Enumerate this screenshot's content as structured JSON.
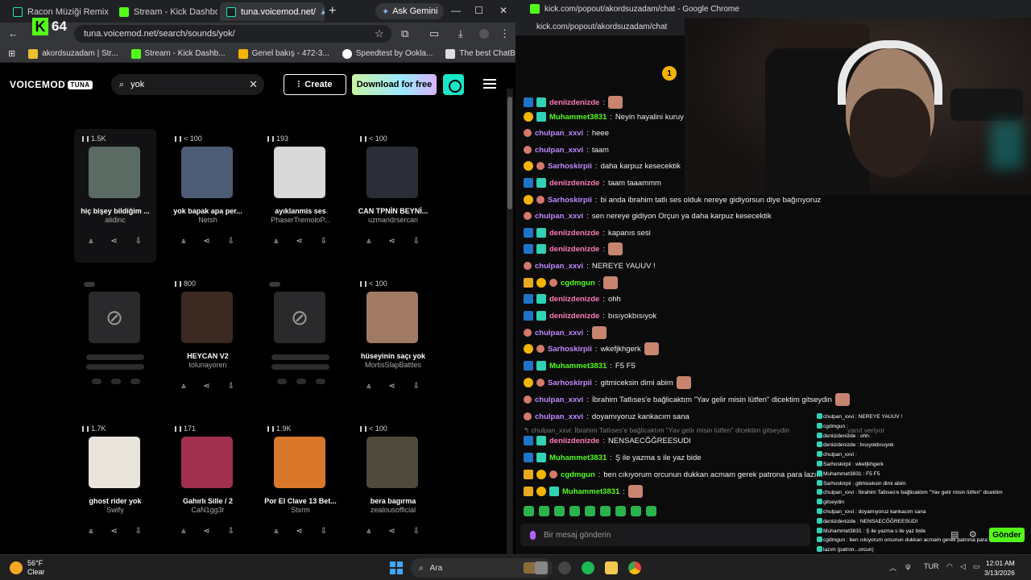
{
  "left_browser": {
    "tabs": [
      {
        "label": "Racon Müziği Remix Tü",
        "favicon": "voicemod-icon"
      },
      {
        "label": "Stream - Kick Dashboar",
        "favicon": "kick-icon"
      },
      {
        "label": "tuna.voicemod.net/",
        "favicon": "voicemod-icon"
      }
    ],
    "ask_gemini": "Ask Gemini",
    "url": "tuna.voicemod.net/search/sounds/yok/",
    "badge_letter": "K",
    "badge_number": "64",
    "bookmarks": [
      "akordsuzadam | Str...",
      "Stream - Kick Dashb...",
      "Genel bakış - 472-3...",
      "Speedtest by Ookla...",
      "The best ChatBot an..."
    ]
  },
  "voicemod": {
    "logo": "VOICEMOD",
    "logo_tag": "TUNA",
    "search_value": "yok",
    "create_label": "Create",
    "download_label": "Download for free",
    "cards": [
      {
        "plays": "1.5K",
        "title": "hiç bişey bildiğim ...",
        "author": "alidinc",
        "thumb": "#5b6b63",
        "placeholder": false
      },
      {
        "plays": "< 100",
        "title": "yok bapak apa per...",
        "author": "Netsh",
        "thumb": "#4d5c75",
        "placeholder": false
      },
      {
        "plays": "193",
        "title": "ayıklanmis ses",
        "author": "PhaserTremoloP...",
        "thumb": "#d9d9d9",
        "placeholder": false
      },
      {
        "plays": "< 100",
        "title": "CAN TPNİN BEYNİ...",
        "author": "uzmandrsercan",
        "thumb": "#2b2e36",
        "placeholder": false
      },
      {
        "plays": "",
        "title": "",
        "author": "",
        "thumb": "",
        "placeholder": true
      },
      {
        "plays": "800",
        "title": "HEYCAN V2",
        "author": "tolunayoren",
        "thumb": "#3b2a22",
        "placeholder": false
      },
      {
        "plays": "",
        "title": "",
        "author": "",
        "thumb": "",
        "placeholder": true
      },
      {
        "plays": "< 100",
        "title": "hüseyinin saçı yok",
        "author": "MortisSlapBattles",
        "thumb": "#a17a63",
        "placeholder": false
      },
      {
        "plays": "1.7K",
        "title": "ghost rider yok",
        "author": "Swify",
        "thumb": "#e9e4dc",
        "placeholder": false
      },
      {
        "plays": "171",
        "title": "Gahırlı Sille / 2",
        "author": "CaN1gg3r",
        "thumb": "#a0304e",
        "placeholder": false
      },
      {
        "plays": "1.9K",
        "title": "Por El Clave 13 Bet...",
        "author": "Stxrm",
        "thumb": "#d9772a",
        "placeholder": false
      },
      {
        "plays": "< 100",
        "title": "bera bagırma",
        "author": "zealousofficial",
        "thumb": "#4f4a3c",
        "placeholder": false
      }
    ]
  },
  "chat_window": {
    "title": "kick.com/popout/akordsuzadam/chat - Google Chrome",
    "url": "kick.com/popout/akordsuzadam/chat",
    "input_placeholder": "Bir mesaj gönderin",
    "send_label": "Gönder",
    "messages": [
      {
        "user": "deniizdenizde",
        "text": "",
        "color": "pink",
        "badges": [
          "gift",
          "sub"
        ],
        "emote": true
      },
      {
        "user": "Muhammet3831",
        "text": "Neyin hayalini kuruy",
        "color": "green",
        "badges": [
          "gold",
          "sub"
        ],
        "emote": false
      },
      {
        "user": "chulpan_xxvi",
        "text": "heee",
        "color": "purple",
        "badges": [
          "star"
        ],
        "emote": false
      },
      {
        "user": "chulpan_xxvi",
        "text": "taam",
        "color": "purple",
        "badges": [
          "star"
        ],
        "emote": false
      },
      {
        "user": "Sarhoskirpii",
        "text": "daha karpuz kesecektik",
        "color": "purple",
        "badges": [
          "gold",
          "star"
        ],
        "emote": false
      },
      {
        "user": "deniizdenizde",
        "text": "taam taaammm",
        "color": "pink",
        "badges": [
          "gift",
          "sub"
        ],
        "emote": false
      },
      {
        "user": "Sarhoskirpii",
        "text": "bi anda ibrahim tatlı ses olduk nereye gidiyorsun diye bağırıyoruz",
        "color": "purple",
        "badges": [
          "gold",
          "star"
        ],
        "emote": false
      },
      {
        "user": "chulpan_xxvi",
        "text": "sen nereye gidiyon Orçun ya daha karpuz kesecektik",
        "color": "purple",
        "badges": [
          "star"
        ],
        "emote": false
      },
      {
        "user": "deniizdenizde",
        "text": "kapanıs sesi",
        "color": "pink",
        "badges": [
          "gift",
          "sub"
        ],
        "emote": false
      },
      {
        "user": "deniizdenizde",
        "text": "",
        "color": "pink",
        "badges": [
          "gift",
          "sub"
        ],
        "emote": true
      },
      {
        "user": "chulpan_xxvi",
        "text": "NEREYE YAUUV !",
        "color": "purple",
        "badges": [
          "star"
        ],
        "emote": false
      },
      {
        "user": "cgdmgun",
        "text": "",
        "color": "green",
        "badges": [
          "crown",
          "gold",
          "star"
        ],
        "emote": true
      },
      {
        "user": "deniizdenizde",
        "text": "ohh",
        "color": "pink",
        "badges": [
          "gift",
          "sub"
        ],
        "emote": false
      },
      {
        "user": "deniizdenizde",
        "text": "bısıyokbısıyok",
        "color": "pink",
        "badges": [
          "gift",
          "sub"
        ],
        "emote": false
      },
      {
        "user": "chulpan_xxvi",
        "text": "",
        "color": "purple",
        "badges": [
          "star"
        ],
        "emote": true
      },
      {
        "user": "Sarhoskirpii",
        "text": "wkefjkhgerk",
        "color": "purple",
        "badges": [
          "gold",
          "star"
        ],
        "emote": true
      },
      {
        "user": "Muhammet3831",
        "text": "F5 F5",
        "color": "green",
        "badges": [
          "gift",
          "sub"
        ],
        "emote": false
      },
      {
        "user": "Sarhoskirpii",
        "text": "gitmiceksin dimi abim",
        "color": "purple",
        "badges": [
          "gold",
          "star"
        ],
        "emote": true
      },
      {
        "user": "chulpan_xxvi",
        "text": "İbrahim Tatlıses'e bağlicaktım \"Yav gelir misin lütfen\" dicektim gitseydin",
        "color": "purple",
        "badges": [
          "star"
        ],
        "emote": true
      },
      {
        "user": "chulpan_xxvi",
        "text": "doyamıyoruz kankacım sana",
        "color": "purple",
        "badges": [
          "star"
        ],
        "emote": false
      },
      {
        "user": "deniizdenizde",
        "text": "NENSAECĞĞREESUDI",
        "color": "pink",
        "badges": [
          "gift",
          "sub"
        ],
        "emote": false
      },
      {
        "user": "Muhammet3831",
        "text": "Ş ile yazma s ile yaz bide",
        "color": "green",
        "badges": [
          "gift",
          "sub"
        ],
        "emote": false
      },
      {
        "user": "cgdmgun",
        "text": "ben cıkıyorum orcunun dukkan acmam gerek patrona para lazım",
        "color": "green",
        "badges": [
          "crown",
          "gold",
          "star"
        ],
        "emote": false
      },
      {
        "user": "Muhammet3831",
        "text": "",
        "color": "green",
        "badges": [
          "crown",
          "gold",
          "sub"
        ],
        "emote": true
      }
    ],
    "reply_ghost": "chulpan_xxvi: İbrahim Tatlıses'e bağlicaktım \"Yav gelir misin lütfen\" dicektim gitseydin",
    "ghost_tail": "yanıt veriyor"
  },
  "overlay": {
    "lines": [
      "chulpan_xxvi : NEREYE YAUUV !",
      "cgdmgun :",
      "deniizdenizde : ohh",
      "deniizdenizde : bısıyokbısıyok",
      "chulpan_xxvi :",
      "Sarhoskirpii : wkefjkhgerk",
      "Muhammet3831 : F5 F5",
      "Sarhoskirpii : gitmiceksin dimi abim",
      "chulpan_xxvi : İbrahim Tatlıses'e bağlicaktım \"Yav gelir misin lütfen\" dicektim",
      "gitseydin",
      "chulpan_xxvi : doyamıyoruz kankacım sana",
      "deniizdenizde : NENSAECĞĞREESUDI",
      "Muhammet3831 : Ş ile yazma s ile yaz bide",
      "cgdmgun : ben cıkıyorum orcunun dukkan acmam gerek patrona para",
      "lazım (patron...orcun)",
      "Muhammet3831 :"
    ]
  },
  "taskbar": {
    "temp": "56°F",
    "weather": "Clear",
    "search_placeholder": "Ara",
    "lang": "TUR",
    "time": "12:01 AM",
    "date": "3/13/2026"
  }
}
